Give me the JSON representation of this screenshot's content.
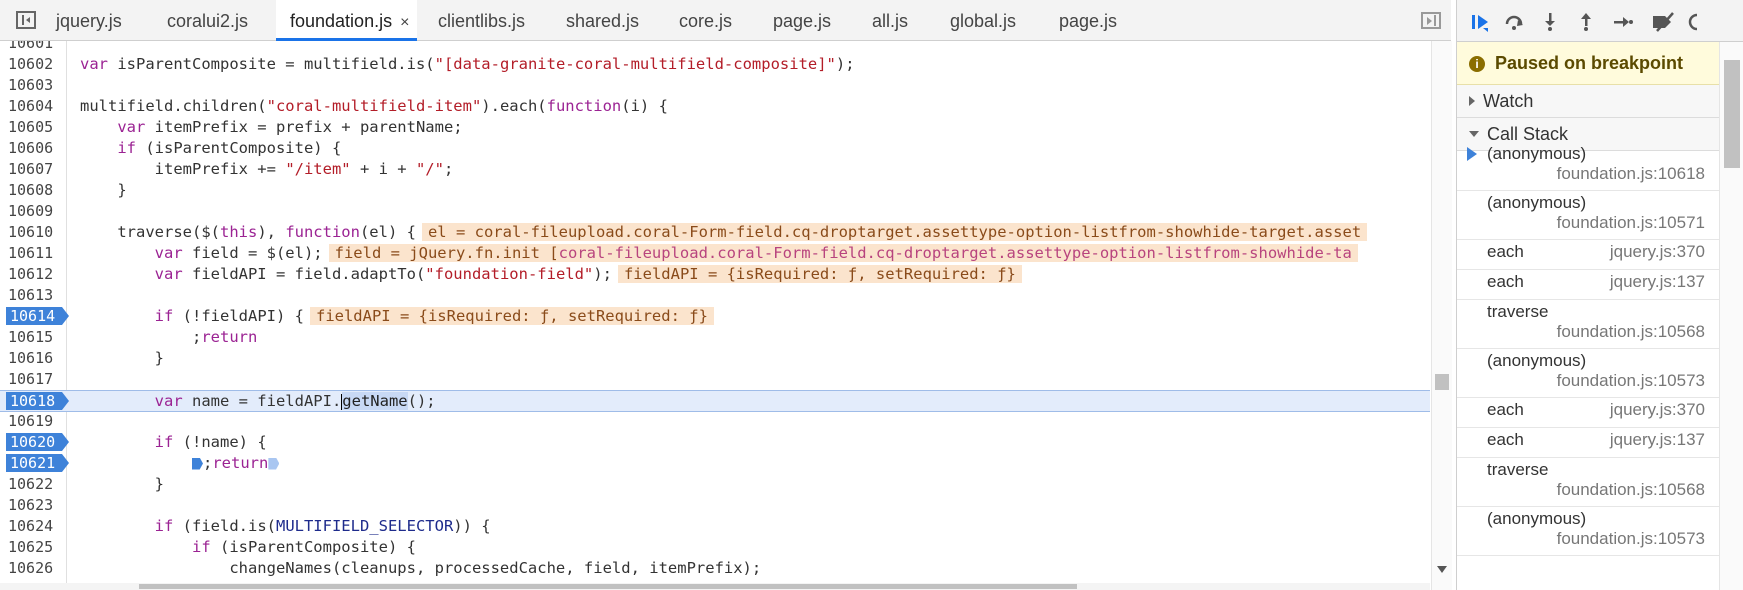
{
  "tabs": [
    {
      "label": "jquery.js"
    },
    {
      "label": "coralui2.js"
    },
    {
      "label": "foundation.js",
      "active": true,
      "close": "×"
    },
    {
      "label": "clientlibs.js"
    },
    {
      "label": "shared.js"
    },
    {
      "label": "core.js"
    },
    {
      "label": "page.js"
    },
    {
      "label": "all.js"
    },
    {
      "label": "global.js"
    },
    {
      "label": "page.js"
    }
  ],
  "code": {
    "lines": [
      {
        "n": "10601"
      },
      {
        "n": "10602",
        "kw": "var",
        "a": " isParentComposite = multifield.is(",
        "s": "\"[data-granite-coral-multifield-composite]\"",
        "b": ");"
      },
      {
        "n": "10603"
      },
      {
        "n": "10604",
        "a": "multifield.children(",
        "s": "\"coral-multifield-item\"",
        "b": ").each(",
        "kw2": "function",
        "c": "(i) {"
      },
      {
        "n": "10605",
        "ind": "    ",
        "kw": "var",
        "a": " itemPrefix = prefix + parentName;"
      },
      {
        "n": "10606",
        "ind": "    ",
        "kw": "if",
        "a": " (isParentComposite) {"
      },
      {
        "n": "10607",
        "ind": "        ",
        "a": "itemPrefix += ",
        "s": "\"/item\"",
        "b": " + i + ",
        "s2": "\"/\"",
        "c": ";"
      },
      {
        "n": "10608",
        "ind": "    ",
        "a": "}"
      },
      {
        "n": "10609"
      },
      {
        "n": "10610",
        "ind": "    ",
        "a": "traverse($(",
        "kw": "this",
        "b": "), ",
        "kw2": "function",
        "c": "(el) {",
        "inline": "el = coral-fileupload.coral-Form-field.cq-droptarget.assettype-option-listfrom-showhide-target.asset"
      },
      {
        "n": "10611",
        "ind": "        ",
        "kw": "var",
        "a": " field = $(el);",
        "inline": "field = jQuery.fn.init [",
        "inlineCls": "coral-fileupload.coral-Form-field.cq-droptarget.assettype-option-listfrom-showhide-ta"
      },
      {
        "n": "10612",
        "ind": "        ",
        "kw": "var",
        "a": " fieldAPI = field.adaptTo(",
        "s": "\"foundation-field\"",
        "b": ");",
        "inline": "fieldAPI = {isRequired: ƒ, setRequired: ƒ}"
      },
      {
        "n": "10613"
      },
      {
        "n": "10614",
        "bp": true,
        "ind": "        ",
        "kw": "if",
        "a": " (!fieldAPI) {",
        "inline": "fieldAPI = {isRequired: ƒ, setRequired: ƒ}"
      },
      {
        "n": "10615",
        "ind": "            ",
        "kw": "return",
        "a": ";"
      },
      {
        "n": "10616",
        "ind": "        ",
        "a": "}"
      },
      {
        "n": "10617"
      },
      {
        "n": "10618",
        "bp": true,
        "exec": true,
        "ind": "        ",
        "kw": "var",
        "a": " name = fieldAPI.",
        "sel": "getName",
        "b": "();"
      },
      {
        "n": "10619"
      },
      {
        "n": "10620",
        "bp": true,
        "ind": "        ",
        "kw": "if",
        "a": " (!name) {"
      },
      {
        "n": "10621",
        "bp": true,
        "ind": "            ",
        "inlbp": true,
        "kw": "return",
        "a": ";"
      },
      {
        "n": "10622",
        "ind": "        ",
        "a": "}"
      },
      {
        "n": "10623"
      },
      {
        "n": "10624",
        "ind": "        ",
        "kw": "if",
        "a": " (field.is(",
        "cn": "MULTIFIELD_SELECTOR",
        "b": ")) {"
      },
      {
        "n": "10625",
        "ind": "            ",
        "kw": "if",
        "a": " (isParentComposite) {"
      },
      {
        "n": "10626",
        "ind": "                ",
        "a": "changeNames(cleanups, processedCache, field, itemPrefix);"
      }
    ]
  },
  "debugger": {
    "paused_text": "Paused on breakpoint",
    "watch_label": "Watch",
    "callstack_label": "Call Stack",
    "frames": [
      {
        "name": "(anonymous)",
        "loc": "foundation.js:10618",
        "current": true,
        "two": true
      },
      {
        "name": "(anonymous)",
        "loc": "foundation.js:10571",
        "two": true
      },
      {
        "name": "each",
        "loc": "jquery.js:370"
      },
      {
        "name": "each",
        "loc": "jquery.js:137"
      },
      {
        "name": "traverse",
        "loc": "foundation.js:10568",
        "two": true
      },
      {
        "name": "(anonymous)",
        "loc": "foundation.js:10573",
        "two": true
      },
      {
        "name": "each",
        "loc": "jquery.js:370"
      },
      {
        "name": "each",
        "loc": "jquery.js:137"
      },
      {
        "name": "traverse",
        "loc": "foundation.js:10568",
        "two": true
      },
      {
        "name": "(anonymous)",
        "loc": "foundation.js:10573",
        "two": true
      }
    ]
  },
  "colors": {
    "accent": "#1a73e8",
    "breakpoint": "#3e82d9",
    "paused_bg": "#fffbdc",
    "inline_value_bg": "#fbe4cd"
  }
}
